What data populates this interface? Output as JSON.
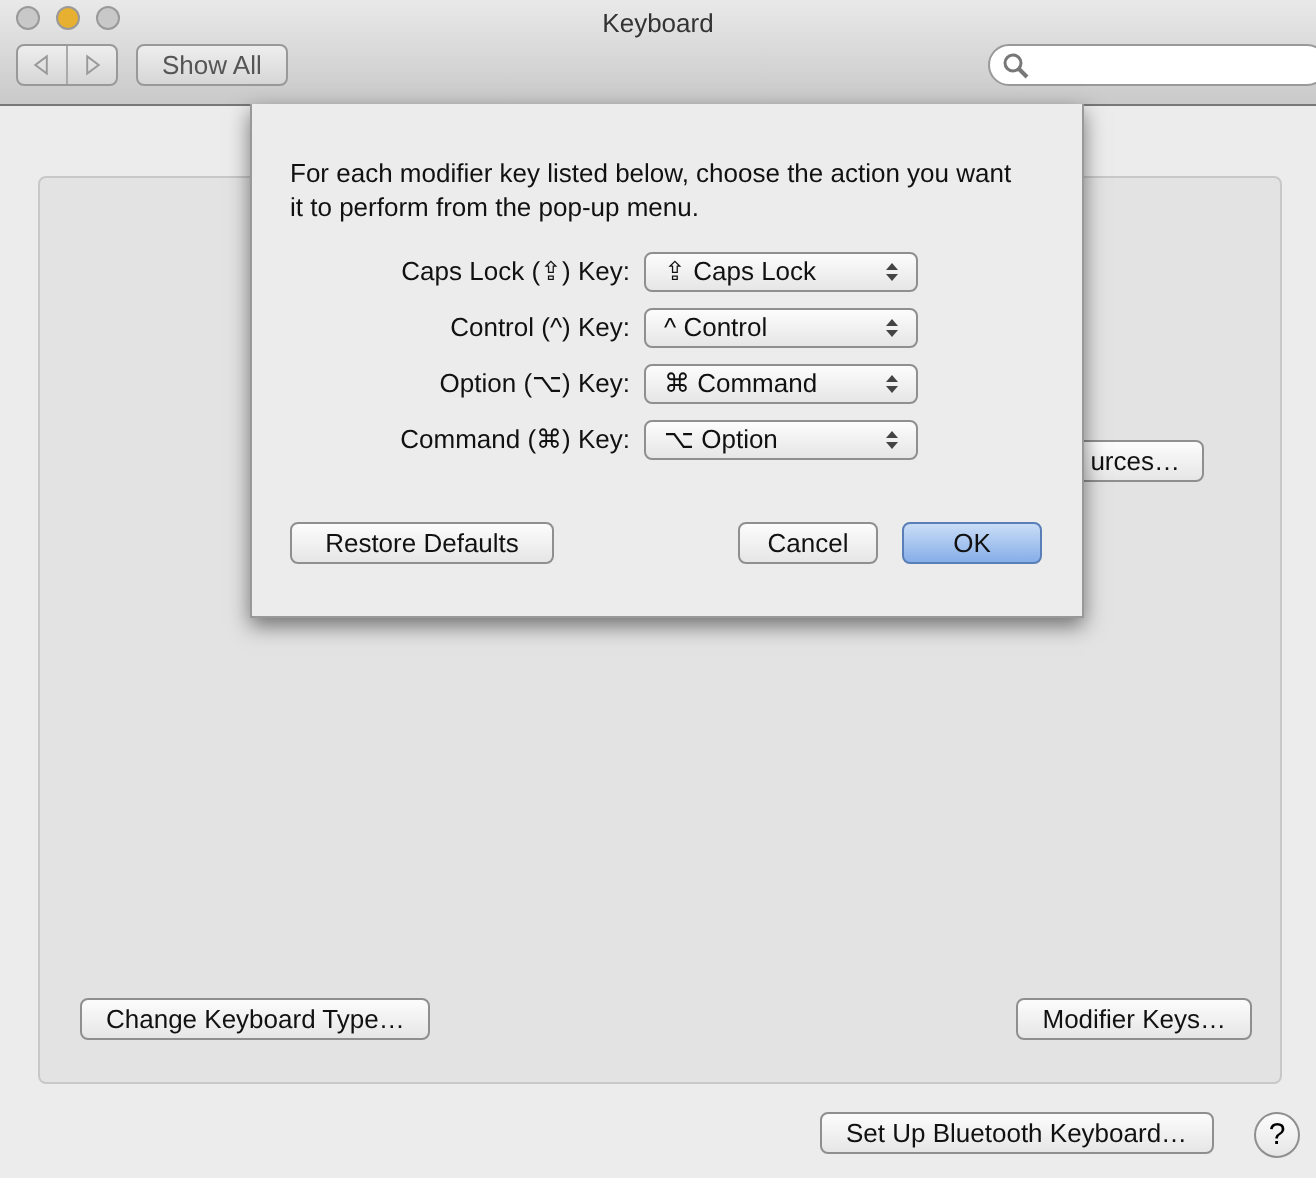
{
  "window": {
    "title": "Keyboard",
    "traffic_lights": [
      {
        "color": "#c8c8c8"
      },
      {
        "color": "#e8b030"
      },
      {
        "color": "#c8c8c8"
      }
    ]
  },
  "toolbar": {
    "show_all": "Show All"
  },
  "panel": {
    "input_sources": "urces…",
    "buttons": [
      "Change Keyboard Type…",
      "Modifier Keys…"
    ]
  },
  "footer": {
    "button": "Set Up Bluetooth Keyboard…",
    "help": "?"
  },
  "sheet": {
    "message": "For each modifier key listed below, choose the action you want it to perform from the pop-up menu.",
    "rows": [
      {
        "label": "Caps Lock (⇪) Key:",
        "value": "⇪ Caps Lock"
      },
      {
        "label": "Control (^) Key:",
        "value": "^ Control"
      },
      {
        "label": "Option (⌥) Key:",
        "value": "⌘ Command"
      },
      {
        "label": "Command (⌘) Key:",
        "value": "⌥ Option"
      }
    ],
    "restore": "Restore Defaults",
    "buttons": [
      {
        "label": "Cancel",
        "default": false
      },
      {
        "label": "OK",
        "default": true
      }
    ]
  }
}
